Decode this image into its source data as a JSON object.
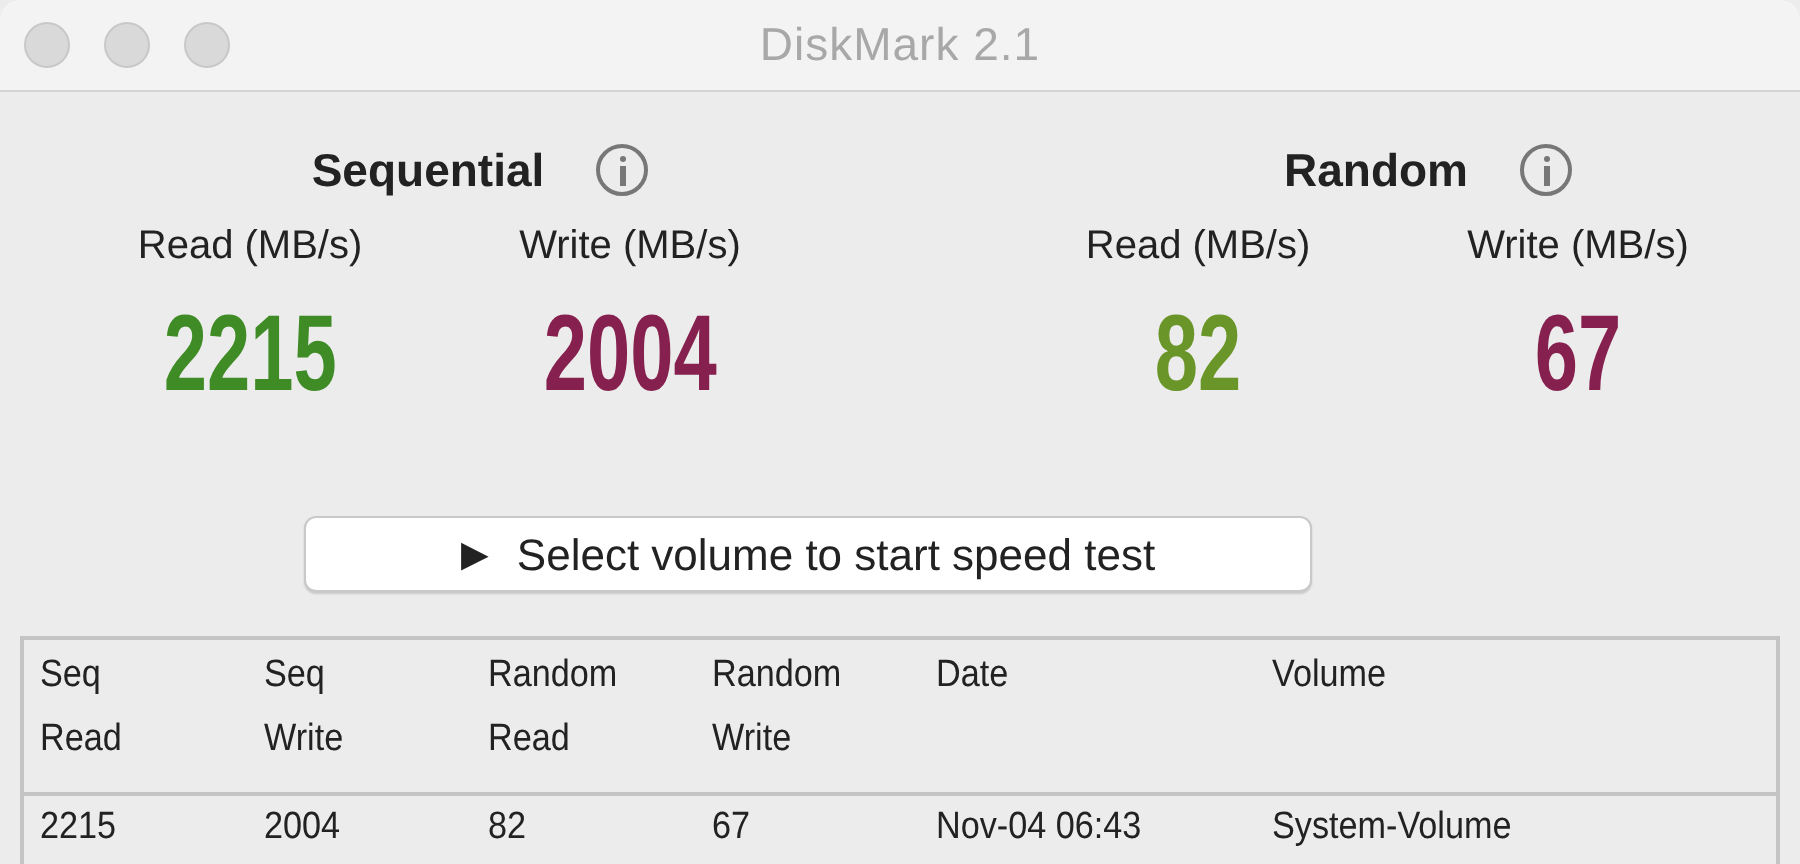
{
  "window": {
    "title": "DiskMark 2.1"
  },
  "sections": [
    {
      "title": "Sequential",
      "metrics": [
        {
          "label": "Read (MB/s)",
          "value": "2215",
          "color": "#3f8c26"
        },
        {
          "label": "Write (MB/s)",
          "value": "2004",
          "color": "#86204f"
        }
      ]
    },
    {
      "title": "Random",
      "metrics": [
        {
          "label": "Read (MB/s)",
          "value": "82",
          "color": "#6a9528"
        },
        {
          "label": "Write (MB/s)",
          "value": "67",
          "color": "#86204f"
        }
      ]
    }
  ],
  "start_button": {
    "icon": "▶",
    "label": "Select volume to start speed test"
  },
  "table": {
    "columns": [
      "Seq Read",
      "Seq Write",
      "Random Read",
      "Random Write",
      "Date",
      "Volume"
    ],
    "rows": [
      [
        "2215",
        "2004",
        "82",
        "67",
        "Nov-04 06:43",
        "System-Volume"
      ]
    ]
  }
}
